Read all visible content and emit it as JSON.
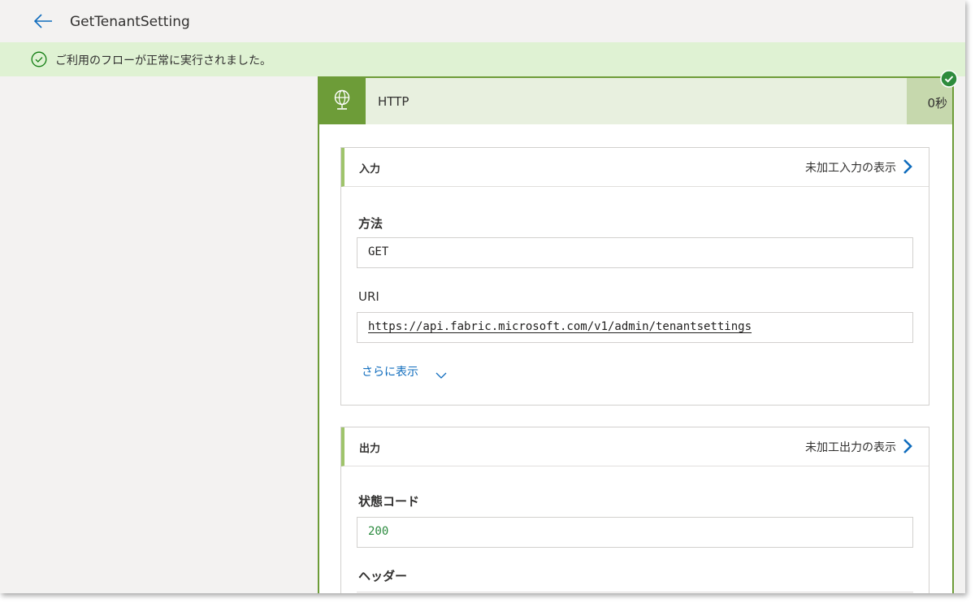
{
  "header": {
    "title": "GetTenantSetting"
  },
  "banner": {
    "message": "ご利用のフローが正常に実行されました。",
    "icon": "check-circle-icon",
    "background": "#dff2d3"
  },
  "action": {
    "name": "HTTP",
    "duration": "0秒",
    "icon": "globe-icon",
    "accent_color": "#6d9c38",
    "status": "succeeded"
  },
  "inputs": {
    "label": "入力",
    "raw_link": "未加工入力の表示",
    "fields": {
      "method_label": "方法",
      "method_value": "GET",
      "uri_label": "URI",
      "uri_value": "https://api.fabric.microsoft.com/v1/admin/tenantsettings"
    },
    "show_more": "さらに表示"
  },
  "outputs": {
    "label": "出力",
    "raw_link": "未加工出力の表示",
    "fields": {
      "status_label": "状態コード",
      "status_value": "200",
      "headers_label": "ヘッダー"
    }
  }
}
